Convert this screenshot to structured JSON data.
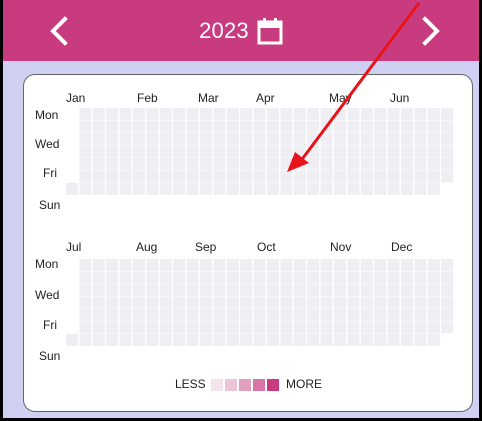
{
  "header": {
    "year": "2023",
    "prev_icon": "chevron-left-icon",
    "next_icon": "chevron-right-icon",
    "calendar_icon": "calendar-icon"
  },
  "heatmap": {
    "first_half_months": [
      "Jan",
      "Feb",
      "Mar",
      "Apr",
      "May",
      "Jun"
    ],
    "second_half_months": [
      "Jul",
      "Aug",
      "Sep",
      "Oct",
      "Nov",
      "Dec"
    ],
    "day_labels": [
      "Mon",
      "Wed",
      "Fri",
      "Sun"
    ],
    "legend_less": "LESS",
    "legend_more": "MORE",
    "cell_color": "#efeff3",
    "legend_colors": [
      "#f4e4ec",
      "#ecc4d7",
      "#e1a0c0",
      "#d774a8",
      "#c93b7f"
    ],
    "activity": "none"
  },
  "colors": {
    "accent": "#c93b7f",
    "background": "#cfd0f2",
    "annotation_arrow": "#e8141b"
  }
}
